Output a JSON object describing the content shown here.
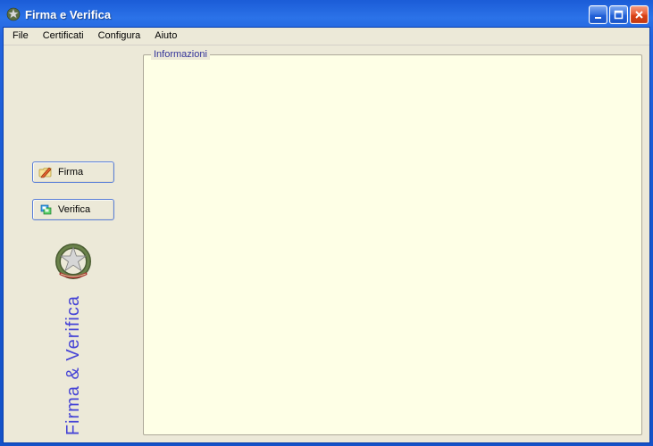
{
  "window": {
    "title": "Firma e Verifica"
  },
  "menu": {
    "file": "File",
    "certificati": "Certificati",
    "configura": "Configura",
    "aiuto": "Aiuto"
  },
  "sidebar": {
    "firma_label": "Firma",
    "verifica_label": "Verifica",
    "brand": "Firma & Verifica"
  },
  "panel": {
    "legend": "Informazioni"
  }
}
